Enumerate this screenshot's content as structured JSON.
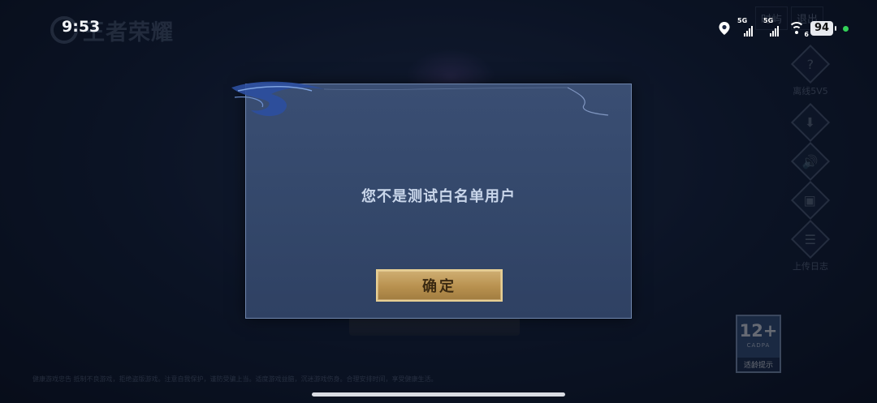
{
  "status_bar": {
    "time": "9:53",
    "signal_1_label": "5G",
    "signal_2_label": "5G",
    "wifi_badge": "6",
    "battery": "94"
  },
  "background": {
    "logo_text": "王者荣耀",
    "top_buttons": [
      "时屿",
      "退出"
    ],
    "side_menu": [
      {
        "icon": "?",
        "label": "离线5V5"
      },
      {
        "icon": "⬇",
        "label": ""
      },
      {
        "icon": "🔊",
        "label": ""
      },
      {
        "icon": "▣",
        "label": ""
      },
      {
        "icon": "☰",
        "label": "上传日志"
      }
    ],
    "age_badge": {
      "num": "12+",
      "org": "CADPA",
      "tip": "适龄提示"
    },
    "footer": "健康游戏忠告 抵制不良游戏，拒绝盗版游戏。注意自我保护，谨防受骗上当。适度游戏益脑，沉迷游戏伤身。合理安排时间，享受健康生活。"
  },
  "dialog": {
    "message": "您不是测试白名单用户",
    "confirm_label": "确定"
  },
  "colors": {
    "dialog_bg": "#34486b",
    "button_gold": "#b8914f",
    "message_text": "#c9d6ea"
  }
}
